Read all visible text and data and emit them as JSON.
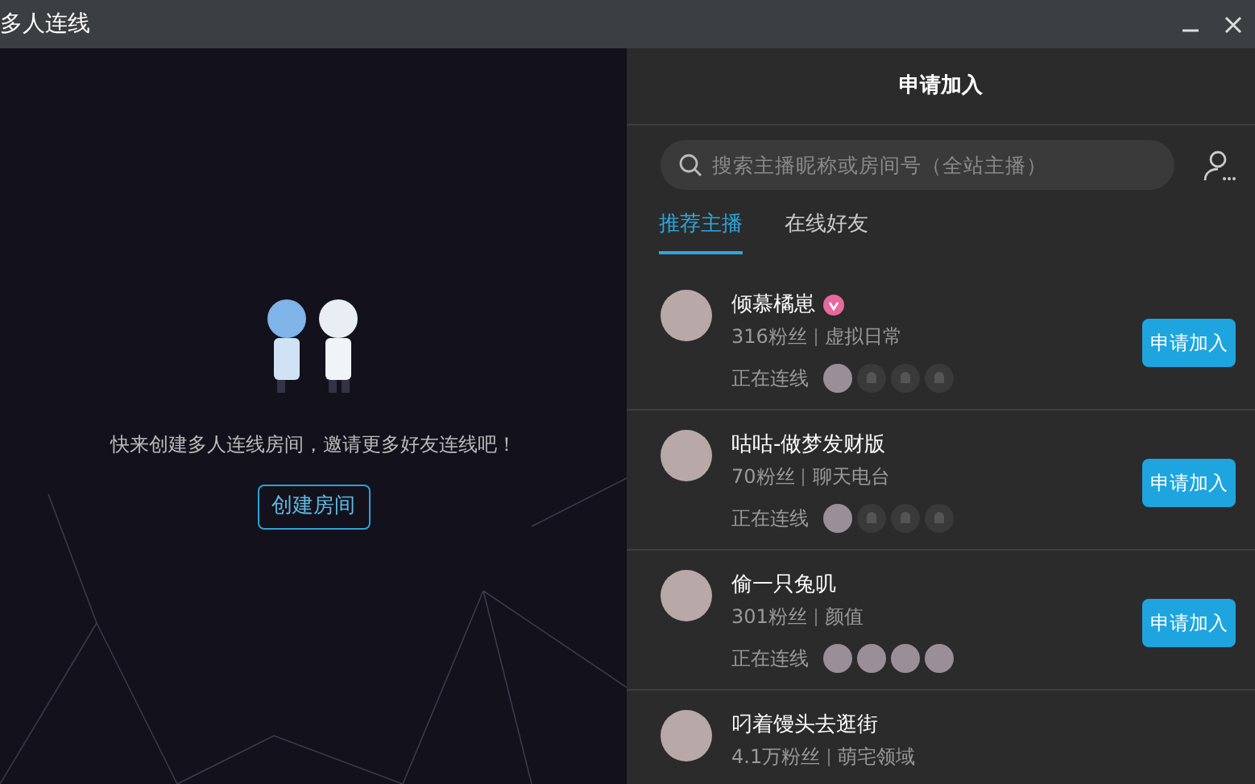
{
  "window": {
    "title": "多人连线"
  },
  "left_panel": {
    "message": "快来创建多人连线房间，邀请更多好友连线吧！",
    "create_button": "创建房间"
  },
  "right_panel": {
    "title": "申请加入",
    "search": {
      "placeholder": "搜索主播昵称或房间号（全站主播）"
    },
    "tabs": [
      {
        "label": "推荐主播",
        "selected": true
      },
      {
        "label": "在线好友",
        "selected": false
      }
    ],
    "streamers": [
      {
        "name": "倾慕橘崽",
        "badge": true,
        "fans": "316粉丝",
        "category": "虚拟日常",
        "status": "正在连线",
        "slots": [
          {
            "occupied": true
          },
          {
            "occupied": false
          },
          {
            "occupied": false
          },
          {
            "occupied": false
          }
        ],
        "button": "申请加入"
      },
      {
        "name": "咕咕-做梦发财版",
        "badge": false,
        "fans": "70粉丝",
        "category": "聊天电台",
        "status": "正在连线",
        "slots": [
          {
            "occupied": true
          },
          {
            "occupied": false
          },
          {
            "occupied": false
          },
          {
            "occupied": false
          }
        ],
        "button": "申请加入"
      },
      {
        "name": "偷一只兔叽",
        "badge": false,
        "fans": "301粉丝",
        "category": "颜值",
        "status": "正在连线",
        "slots": [
          {
            "occupied": true
          },
          {
            "occupied": true
          },
          {
            "occupied": true
          },
          {
            "occupied": true
          }
        ],
        "button": "申请加入"
      },
      {
        "name": "叼着馒头去逛街",
        "badge": false,
        "fans": "4.1万粉丝",
        "category": "萌宅领域"
      }
    ]
  }
}
